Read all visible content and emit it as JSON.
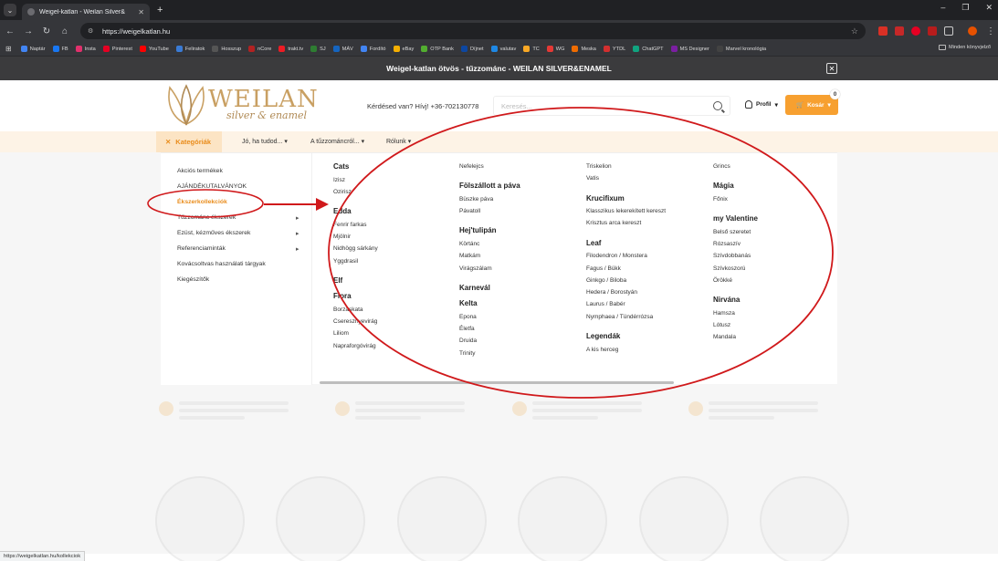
{
  "browser": {
    "tab_title": "Weigel-katlan - Weilan Silver&",
    "url": "https://weigelkatlan.hu",
    "bookmarks": [
      {
        "label": "Naptár",
        "color": "#4285f4"
      },
      {
        "label": "FB",
        "color": "#1877f2"
      },
      {
        "label": "Insta",
        "color": "#e1306c"
      },
      {
        "label": "Pinterest",
        "color": "#e60023"
      },
      {
        "label": "YouTube",
        "color": "#ff0000"
      },
      {
        "label": "Feliratok",
        "color": "#3a7bd5"
      },
      {
        "label": "Hosszup",
        "color": "#555555"
      },
      {
        "label": "nCore",
        "color": "#b22222"
      },
      {
        "label": "trakt.tv",
        "color": "#ed1c24"
      },
      {
        "label": "SJ",
        "color": "#2e7d32"
      },
      {
        "label": "MÁV",
        "color": "#1565c0"
      },
      {
        "label": "Fordító",
        "color": "#4285f4"
      },
      {
        "label": "eBay",
        "color": "#f5af02"
      },
      {
        "label": "OTP Bank",
        "color": "#52ae30"
      },
      {
        "label": "Díjnet",
        "color": "#0d47a1"
      },
      {
        "label": "valutav",
        "color": "#1e88e5"
      },
      {
        "label": "TC",
        "color": "#f9a825"
      },
      {
        "label": "WG",
        "color": "#e53935"
      },
      {
        "label": "Meska",
        "color": "#ef6c00"
      },
      {
        "label": "YTDL",
        "color": "#d32f2f"
      },
      {
        "label": "ChatGPT",
        "color": "#10a37f"
      },
      {
        "label": "MS Designer",
        "color": "#7b1fa2"
      },
      {
        "label": "Marvel kronológia",
        "color": "#424242"
      }
    ],
    "all_bookmarks": "Minden könyvjelző",
    "status_url": "https://weigelkatlan.hu/kollekciok"
  },
  "site": {
    "banner": "Weigel-katlan ötvös - tűzzománc - WEILAN SILVER&ENAMEL",
    "logo_word": "WEILAN",
    "logo_sub": "silver & enamel",
    "phone": "Kérdésed van? Hívj! +36-702130778",
    "search_placeholder": "Keresés...",
    "profile": "Profil",
    "cart": "Kosár",
    "cart_count": "0"
  },
  "nav": {
    "categories": "Kategóriák",
    "items": [
      "Jó, ha tudod...",
      "A tűzzománcról...",
      "Rólunk"
    ]
  },
  "left_menu": [
    {
      "label": "Akciós termékek",
      "chevron": false
    },
    {
      "label": "AJÁNDÉKUTALVÁNYOK",
      "chevron": false
    },
    {
      "label": "Ékszerkollekciók",
      "chevron": false,
      "active": true
    },
    {
      "label": "Tűzzománc ékszerek",
      "chevron": true
    },
    {
      "label": "Ezüst, kézműves ékszerek",
      "chevron": true
    },
    {
      "label": "Referenciaminták",
      "chevron": true
    },
    {
      "label": "Kovácsoltvas használati tárgyak",
      "chevron": false
    },
    {
      "label": "Kiegészítők",
      "chevron": false
    }
  ],
  "collections": [
    [
      {
        "title": "Cats",
        "items": [
          "Izisz",
          "Ozirisz"
        ]
      },
      {
        "title": "Edda",
        "items": [
          "Fenrir farkas",
          "Mjölnir",
          "Nidhögg sárkány",
          "Yggdrasil"
        ]
      },
      {
        "title": "Elf",
        "items": []
      },
      {
        "title": "Flora",
        "items": [
          "Borzaskata",
          "Cseresznyevirág",
          "Liliom",
          "Napraforgóvirág"
        ]
      }
    ],
    [
      {
        "title": "",
        "items": [
          "Nefelejcs"
        ]
      },
      {
        "title": "Fölszállott a páva",
        "items": [
          "Büszke páva",
          "Pávatoll"
        ]
      },
      {
        "title": "Hej'tulipán",
        "items": [
          "Körtánc",
          "Matkám",
          "Virágszálam"
        ]
      },
      {
        "title": "Karnevál",
        "items": []
      },
      {
        "title": "Kelta",
        "items": [
          "Epona",
          "Életfa",
          "Druida",
          "Trinity"
        ]
      }
    ],
    [
      {
        "title": "",
        "items": [
          "Triskelion",
          "Vatis"
        ]
      },
      {
        "title": "Krucifixum",
        "items": [
          "Klasszikus lekerekített kereszt",
          "Krisztus arca kereszt"
        ]
      },
      {
        "title": "Leaf",
        "items": [
          "Filodendron / Monstera",
          "Fagus / Bükk",
          "Ginkgo / Biloba",
          "Hedera / Borostyán",
          "Laurus / Babér",
          "Nymphaea / Tündérrózsa"
        ]
      },
      {
        "title": "Legendák",
        "items": [
          "A kis herceg"
        ]
      }
    ],
    [
      {
        "title": "",
        "items": [
          "Grincs"
        ]
      },
      {
        "title": "Mágia",
        "items": [
          "Főnix"
        ]
      },
      {
        "title": "my Valentine",
        "items": [
          "Belső szeretet",
          "Rózsaszív",
          "Szívdobbanás",
          "Szívkoszorú",
          "Örökké"
        ]
      },
      {
        "title": "Nirvána",
        "items": [
          "Hamsza",
          "Lótusz",
          "Mandala"
        ]
      }
    ]
  ],
  "annotation": {
    "color": "#d0191b"
  }
}
